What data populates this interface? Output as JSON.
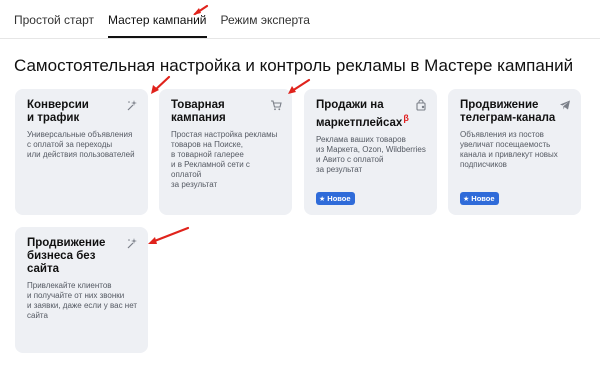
{
  "tabs": [
    {
      "label": "Простой старт"
    },
    {
      "label": "Мастер кампаний"
    },
    {
      "label": "Режим эксперта"
    }
  ],
  "page_title": "Самостоятельная настройка и контроль рекламы в Мастере кампаний",
  "cards": [
    {
      "title_line1": "Конверсии",
      "title_line2": "и трафик",
      "desc": [
        "Универсальные объявления",
        "с оплатой за переходы",
        "или действия пользователей"
      ],
      "icon": "sparkle-icon"
    },
    {
      "title_line1": "Товарная",
      "title_line2": "кампания",
      "desc": [
        "Простая настройка рекламы",
        "товаров на Поиске,",
        "в товарной галерее",
        "и в Рекламной сети с оплатой",
        "за результат"
      ],
      "icon": "cart-icon"
    },
    {
      "title_line1": "Продажи на",
      "title_line2": "маркетплейсах",
      "beta": "β",
      "desc": [
        "Реклама ваших товаров",
        "из Маркета, Ozon, Wildberries",
        "и Авито с оплатой",
        "за результат"
      ],
      "icon": "bag-icon",
      "badge": "Новое"
    },
    {
      "title_line1": "Продвижение",
      "title_line2": "телеграм-канала",
      "desc": [
        "Объявления из постов",
        "увеличат посещаемость",
        "канала и привлекут новых",
        "подписчиков"
      ],
      "icon": "telegram-icon",
      "badge": "Новое"
    },
    {
      "title_line1": "Продвижение",
      "title_line2": "бизнеса без сайта",
      "desc": [
        "Привлекайте клиентов",
        "и получайте от них звонки",
        "и заявки, даже если у вас нет",
        "сайта"
      ],
      "icon": "sparkle-icon"
    }
  ],
  "colors": {
    "arrow": "#e0231c",
    "badge": "#2f6bd9",
    "card_bg": "#eef0f4"
  }
}
